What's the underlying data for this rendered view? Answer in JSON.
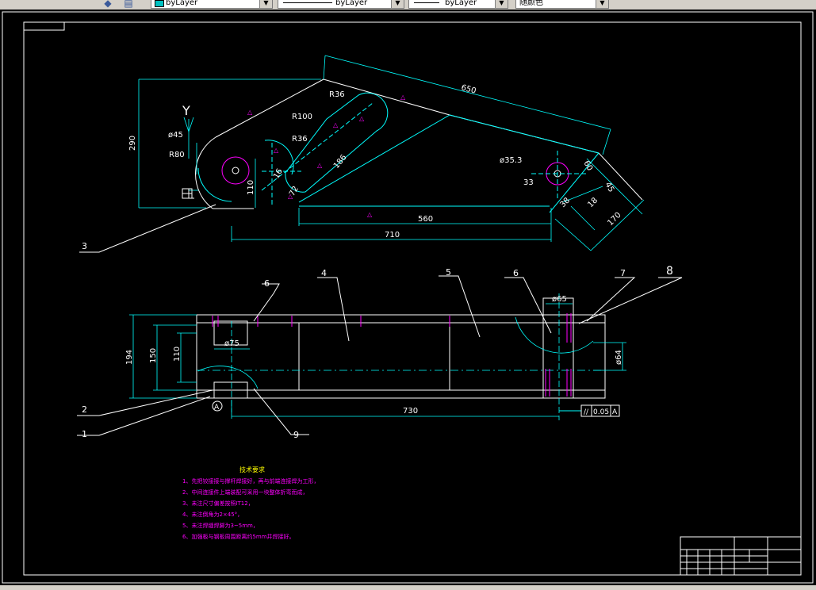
{
  "toolbar": {
    "layer_color_combo": "byLayer",
    "linetype_combo": "byLayer",
    "lineweight_combo": "byLayer",
    "plotstyle_combo": "随颜色"
  },
  "drawing": {
    "dimensions": {
      "d650": "650",
      "r36_a": "R36",
      "r100": "R100",
      "r36_b": "R36",
      "d290": "290",
      "phi45": "ø45",
      "r80": "R80",
      "d110_a": "110",
      "y_axis": "Y",
      "d186": "186",
      "d16": "16",
      "d72": "72",
      "phi35_3": "ø35.3",
      "d33": "33",
      "d60": "60",
      "d45": "45",
      "d38": "38",
      "d18": "18",
      "d170": "170",
      "d560": "560",
      "d710": "710",
      "phi65": "ø65",
      "phi75": "ø75",
      "d194": "194",
      "d150": "150",
      "d110_b": "110",
      "phi64": "ø64",
      "d730": "730",
      "tol_sym": "//",
      "tol_val": "0.05",
      "tol_datum": "A",
      "datum_a": "A"
    },
    "leaders": {
      "n1": "1",
      "n2": "2",
      "n3": "3",
      "n4": "4",
      "n5": "5",
      "n6a": "6",
      "n6b": "6",
      "n7": "7",
      "n8": "8",
      "n9": "9"
    },
    "notes": {
      "title": "技术要求",
      "items": [
        "1、先把铰接接与撑杆焊接好，再与前端连接焊为工形，",
        "2、中间连接件上端装配可采用一块整体折弯而成，",
        "3、未注尺寸偏差按照IT12，",
        "4、未注倒角为2×45°，",
        "5、未注焊缝焊脚为3~5mm，",
        "6、加强板与钢板周围距离约5mm并焊接好。"
      ]
    }
  }
}
